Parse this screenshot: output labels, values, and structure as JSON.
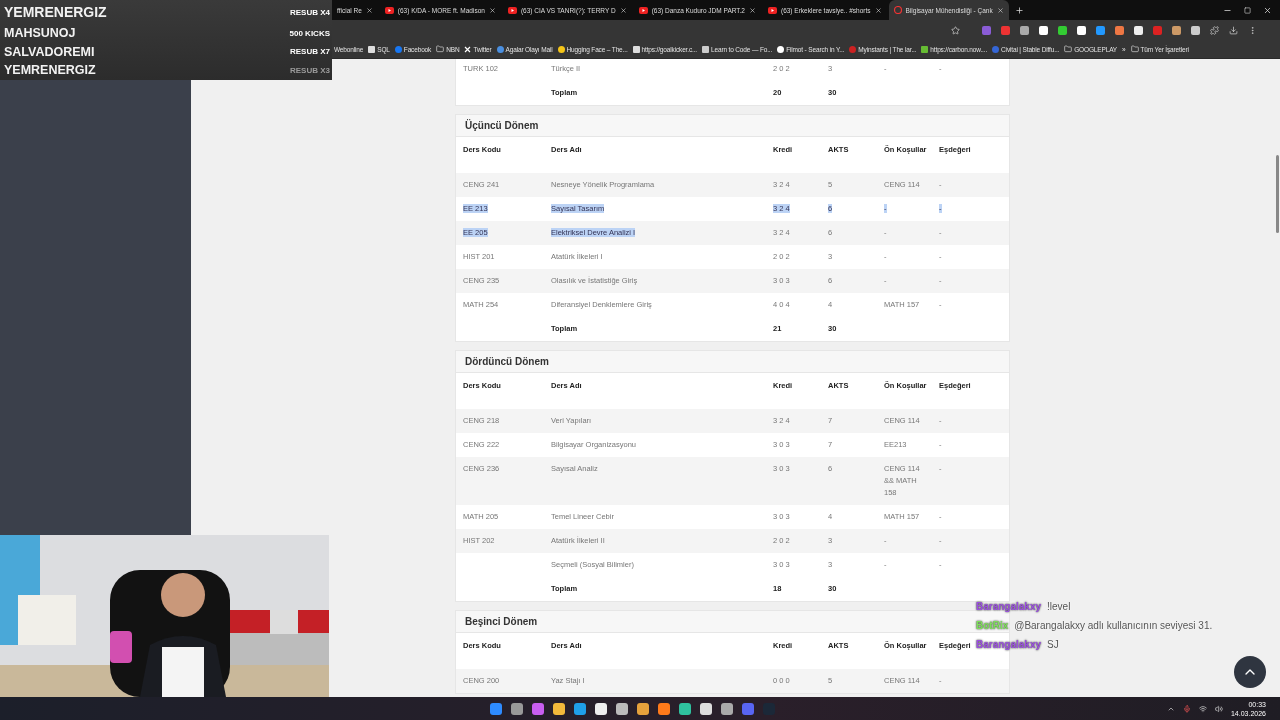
{
  "stream_alerts": [
    {
      "name": "YEMRENERGIZ",
      "label": "RESUB X4",
      "dim": false
    },
    {
      "name": "MAHSUNOJ",
      "label": "500 KICKS",
      "dim": false
    },
    {
      "name": "SALVADOREMI",
      "label": "RESUB X7",
      "dim": false
    },
    {
      "name": "YEMRENERGIZ",
      "label": "RESUB X3",
      "dim": true
    }
  ],
  "tabs": [
    {
      "title": "fficial Re",
      "kind": "cut",
      "selected": false
    },
    {
      "title": "(63) K/DA - MORE ft. Madison",
      "kind": "video",
      "selected": false
    },
    {
      "title": "(63) CIA VS TANRI(?): TERRY D",
      "kind": "video",
      "selected": false
    },
    {
      "title": "(63) Danza Kuduro JDM PART.2",
      "kind": "video",
      "selected": false
    },
    {
      "title": "(63) Erkeklere tavsiye.. #shorts",
      "kind": "video",
      "selected": false
    },
    {
      "title": "Bilgisayar Mühendisliği - Çank",
      "kind": "site",
      "selected": true
    }
  ],
  "bookmarks": [
    {
      "label": "Webonline",
      "kind": "plain"
    },
    {
      "label": "SQL",
      "kind": "doc"
    },
    {
      "label": "Facebook",
      "kind": "facebook"
    },
    {
      "label": "NBN",
      "kind": "folder"
    },
    {
      "label": "Twitter",
      "kind": "x"
    },
    {
      "label": "Agalar Olayı Mail",
      "kind": "cloud"
    },
    {
      "label": "Hugging Face – The...",
      "kind": "face"
    },
    {
      "label": "https://goalkicker.c...",
      "kind": "doc"
    },
    {
      "label": "Learn to Code — Fo...",
      "kind": "code"
    },
    {
      "label": "Filmot - Search in Y...",
      "kind": "dot"
    },
    {
      "label": "Myinstants | The lar...",
      "kind": "red"
    },
    {
      "label": "https://carbon.now....",
      "kind": "square"
    },
    {
      "label": "Civitai | Stable Diffu...",
      "kind": "circle"
    },
    {
      "label": "GOOGLEPLAY",
      "kind": "folder"
    },
    {
      "label": "»",
      "kind": "plain"
    },
    {
      "label": "Tüm Yer İşaretleri",
      "kind": "folder"
    }
  ],
  "sections": [
    {
      "rows": [
        {
          "code": "TURK 102",
          "name": "Türkçe II",
          "kredi": "2 0 2",
          "akts": "3",
          "on": "-",
          "esd": "-",
          "start_selected": false,
          "end_selected": false
        }
      ],
      "total": {
        "label": "Toplam",
        "kredi": "20",
        "akts": "30"
      }
    },
    {
      "title": "Üçüncü Dönem",
      "columns": [
        "Ders Kodu",
        "Ders Adı",
        "Kredi",
        "AKTS",
        "Ön Koşullar",
        "Eşdeğeri"
      ],
      "rows": [
        {
          "code": "CENG 241",
          "name": "Nesneye Yönelik Programlama",
          "kredi": "3 2 4",
          "akts": "5",
          "on": "CENG 114",
          "esd": "-",
          "start_selected": false,
          "end_selected": false
        },
        {
          "code": "EE 213",
          "name": "Sayısal Tasarım",
          "kredi": "3 2 4",
          "akts": "6",
          "on": "-",
          "esd": "-",
          "start_selected": true,
          "end_selected": true
        },
        {
          "code": "EE 205",
          "name": "Elektriksel Devre Analizi I",
          "kredi": "3 2 4",
          "akts": "6",
          "on": "-",
          "esd": "-",
          "start_selected": true,
          "end_selected": false
        },
        {
          "code": "HIST 201",
          "name": "Atatürk İlkeleri I",
          "kredi": "2 0 2",
          "akts": "3",
          "on": "-",
          "esd": "-",
          "start_selected": false,
          "end_selected": false
        },
        {
          "code": "CENG 235",
          "name": "Olasılık ve İstatistiğe Giriş",
          "kredi": "3 0 3",
          "akts": "6",
          "on": "-",
          "esd": "-",
          "start_selected": false,
          "end_selected": false
        },
        {
          "code": "MATH 254",
          "name": "Diferansiyel Denklemlere Giriş",
          "kredi": "4 0 4",
          "akts": "4",
          "on": "MATH 157",
          "esd": "-",
          "start_selected": false,
          "end_selected": false
        }
      ],
      "total": {
        "label": "Toplam",
        "kredi": "21",
        "akts": "30"
      }
    },
    {
      "title": "Dördüncü Dönem",
      "columns": [
        "Ders Kodu",
        "Ders Adı",
        "Kredi",
        "AKTS",
        "Ön Koşullar",
        "Eşdeğeri"
      ],
      "rows": [
        {
          "code": "CENG 218",
          "name": "Veri Yapıları",
          "kredi": "3 2 4",
          "akts": "7",
          "on": "CENG 114",
          "esd": "-",
          "start_selected": false,
          "end_selected": false
        },
        {
          "code": "CENG 222",
          "name": "Bilgisayar Organizasyonu",
          "kredi": "3 0 3",
          "akts": "7",
          "on": "EE213",
          "esd": "-",
          "start_selected": false,
          "end_selected": false
        },
        {
          "code": "CENG 236",
          "name": "Sayısal Analiz",
          "kredi": "3 0 3",
          "akts": "6",
          "on": "CENG 114 && MATH 158",
          "esd": "-",
          "start_selected": false,
          "end_selected": false
        },
        {
          "code": "MATH 205",
          "name": "Temel Lineer Cebir",
          "kredi": "3 0 3",
          "akts": "4",
          "on": "MATH 157",
          "esd": "-",
          "start_selected": false,
          "end_selected": false
        },
        {
          "code": "HIST 202",
          "name": "Atatürk İlkeleri II",
          "kredi": "2 0 2",
          "akts": "3",
          "on": "-",
          "esd": "-",
          "start_selected": false,
          "end_selected": false
        },
        {
          "name": "Seçmeli (Sosyal Bilimler)",
          "kredi": "3 0 3",
          "akts": "3",
          "on": "-",
          "esd": "-",
          "start_selected": false,
          "end_selected": false
        }
      ],
      "total": {
        "label": "Toplam",
        "kredi": "18",
        "akts": "30"
      }
    },
    {
      "title": "Beşinci Dönem",
      "columns": [
        "Ders Kodu",
        "Ders Adı",
        "Kredi",
        "AKTS",
        "Ön Koşullar",
        "Eşdeğeri"
      ],
      "rows": [
        {
          "code": "CENG 200",
          "name": "Yaz Stajı I",
          "kredi": "0 0 0",
          "akts": "5",
          "on": "CENG 114",
          "esd": "-",
          "start_selected": false,
          "end_selected": false
        }
      ]
    }
  ],
  "chat": [
    {
      "user": "Barangalakxy",
      "color": "#9b4fe0",
      "message": "!level"
    },
    {
      "user": "BotRix",
      "color": "#7ee05a",
      "message": "@Barangalakxy adlı kullanıcının seviyesi 31."
    },
    {
      "user": "Barangalakxy",
      "color": "#9b4fe0",
      "message": "SJ"
    }
  ],
  "clock": {
    "time": "00:33",
    "date": "14.03.2026"
  }
}
